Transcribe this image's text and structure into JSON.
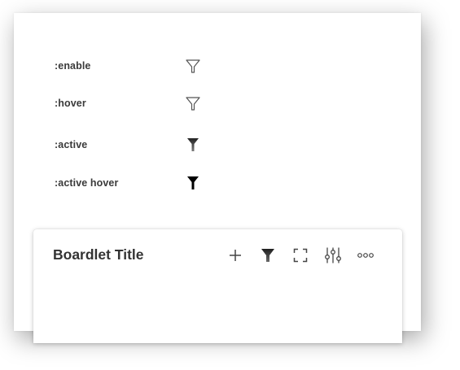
{
  "states": [
    {
      "label": ":enable",
      "icon": "filter-outline-icon",
      "style": "outline",
      "color": "#555555"
    },
    {
      "label": ":hover",
      "icon": "filter-outline-icon",
      "style": "outline",
      "color": "#555555"
    },
    {
      "label": ":active",
      "icon": "filter-filled-icon",
      "style": "filled",
      "color": "#333333"
    },
    {
      "label": ":active hover",
      "icon": "filter-filled-icon",
      "style": "filled",
      "color": "#000000"
    }
  ],
  "boardlet": {
    "title": "Boardlet Title",
    "toolbar": [
      {
        "name": "add",
        "icon": "plus-icon"
      },
      {
        "name": "filter",
        "icon": "filter-filled-icon"
      },
      {
        "name": "fullscreen",
        "icon": "expand-icon"
      },
      {
        "name": "settings",
        "icon": "sliders-icon"
      },
      {
        "name": "more",
        "icon": "more-horizontal-icon"
      }
    ]
  },
  "colors": {
    "text": "#333333",
    "icon": "#444444",
    "background": "#ffffff"
  }
}
